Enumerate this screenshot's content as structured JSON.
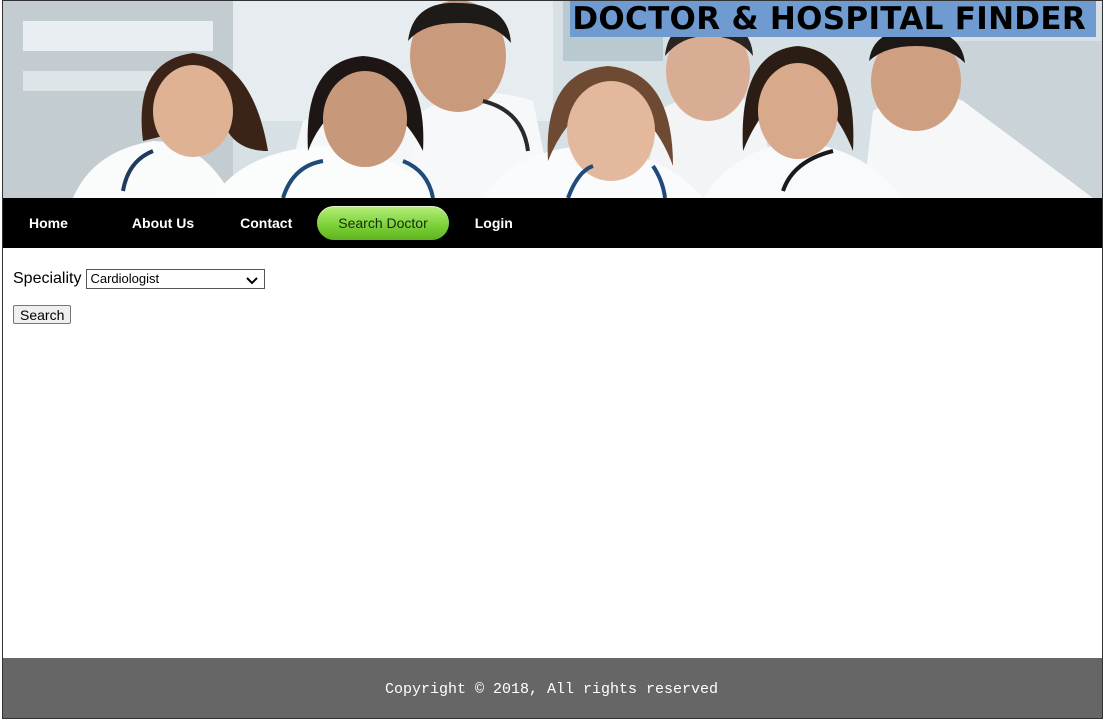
{
  "header": {
    "site_title": "DOCTOR & HOSPITAL FINDER",
    "title_bg_color": "#6f9bd1",
    "banner_image": "group-of-doctors-photo"
  },
  "nav": {
    "items": [
      {
        "label": "Home"
      },
      {
        "label": "About Us"
      },
      {
        "label": "Contact"
      },
      {
        "label": "Search Doctor",
        "active": true
      },
      {
        "label": "Login"
      }
    ],
    "active_color": "#7dd33a"
  },
  "form": {
    "speciality_label": "Speciality",
    "speciality_value": "Cardiologist",
    "search_button": "Search"
  },
  "footer": {
    "text": "Copyright © 2018, All rights reserved"
  },
  "icons": {
    "dropdown": "chevron-down-icon"
  }
}
